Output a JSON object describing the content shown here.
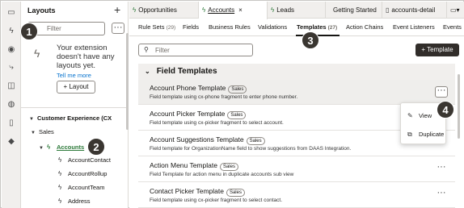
{
  "rail": {
    "icons": [
      "monitor-icon",
      "bolt-icon",
      "extension-icon",
      "flow-icon",
      "event-icon",
      "globe-icon",
      "document-icon",
      "settings-icon"
    ]
  },
  "left_panel": {
    "title": "Layouts",
    "filter_placeholder": "Filter",
    "empty_message": "Your extension doesn't have any layouts yet.",
    "tell_me_more": "Tell me more",
    "add_layout_label": "Layout",
    "tree": [
      {
        "label": "Customer Experience (CX",
        "level": 0
      },
      {
        "label": "Sales",
        "level": 1
      },
      {
        "label": "Accounts",
        "level": 2
      },
      {
        "label": "AccountContact",
        "level": 3
      },
      {
        "label": "AccountRollup",
        "level": 3
      },
      {
        "label": "AccountTeam",
        "level": 3
      },
      {
        "label": "Address",
        "level": 3
      }
    ]
  },
  "tabs": [
    {
      "label": "Opportunities",
      "active": false
    },
    {
      "label": "Accounts",
      "active": true,
      "close": "×"
    },
    {
      "label": "Leads",
      "active": false
    },
    {
      "label": "Getting Started",
      "active": false
    },
    {
      "label": "accounts-detail",
      "active": false
    }
  ],
  "subnav": [
    {
      "label": "Rule Sets",
      "count": "(29)"
    },
    {
      "label": "Fields",
      "count": ""
    },
    {
      "label": "Business Rules",
      "count": ""
    },
    {
      "label": "Validations",
      "count": ""
    },
    {
      "label": "Templates",
      "count": "(27)",
      "active": true
    },
    {
      "label": "Action Chains",
      "count": ""
    },
    {
      "label": "Event Listeners",
      "count": ""
    },
    {
      "label": "Events",
      "count": ""
    }
  ],
  "search_placeholder": "Filter",
  "add_template_label": "Template",
  "section_title": "Field Templates",
  "rows": [
    {
      "name": "Account Phone Template",
      "tag": "Sales",
      "desc": "Field template using cx-phone fragment to enter phone number.",
      "selected": true
    },
    {
      "name": "Account Picker Template",
      "tag": "Sales",
      "desc": "Field template using cx-picker fragment to select account."
    },
    {
      "name": "Account Suggestions Template",
      "tag": "Sales",
      "desc": "Field template for OrganizationName field to show suggestions from DAAS Integration."
    },
    {
      "name": "Action Menu Template",
      "tag": "Sales",
      "desc": "Field Template for action menu in duplicate accounts sub view"
    },
    {
      "name": "Contact Picker Template",
      "tag": "Sales",
      "desc": "Field template using cx-picker fragment to select contact."
    }
  ],
  "menu": {
    "view": "View",
    "duplicate": "Duplicate"
  },
  "callouts": [
    "1",
    "2",
    "3",
    "4"
  ],
  "colors": {
    "accent_dark": "#312d2a",
    "link": "#0572ce",
    "callout": "#3a3631"
  }
}
